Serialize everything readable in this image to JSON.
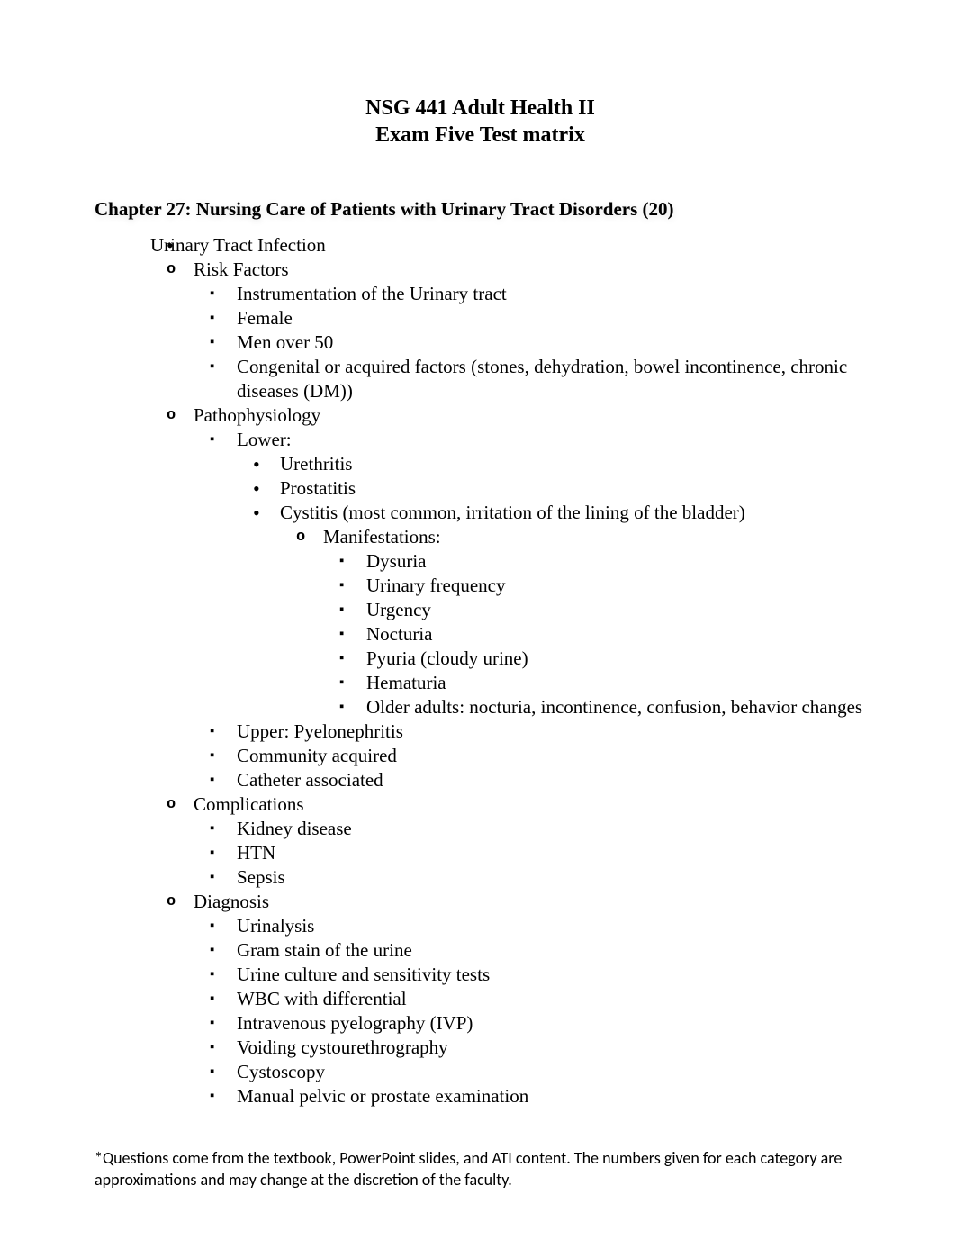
{
  "title": {
    "line1": "NSG 441 Adult Health II",
    "line2": "Exam Five Test matrix"
  },
  "chapter_heading": "Chapter 27: Nursing Care of Patients with Urinary Tract Disorders (20)",
  "outline": {
    "topic": "Urinary Tract Infection",
    "sections": {
      "risk_factors": {
        "label": "Risk Factors",
        "items": [
          "Instrumentation of the Urinary tract",
          "Female",
          "Men over 50",
          "Congenital or acquired factors (stones, dehydration, bowel incontinence, chronic diseases (DM))"
        ]
      },
      "pathophysiology": {
        "label": "Pathophysiology",
        "lower": {
          "label": "Lower:",
          "items": {
            "urethritis": "Urethritis",
            "prostatitis": "Prostatitis",
            "cystitis": {
              "label": "Cystitis (most common, irritation of the lining of the bladder)",
              "manifestations_label": "Manifestations:",
              "manifestations": [
                "Dysuria",
                "Urinary frequency",
                "Urgency",
                "Nocturia",
                "Pyuria (cloudy urine)",
                "Hematuria",
                "Older adults: nocturia, incontinence, confusion, behavior changes"
              ]
            }
          }
        },
        "other_items": [
          "Upper: Pyelonephritis",
          "Community acquired",
          "Catheter associated"
        ]
      },
      "complications": {
        "label": "Complications",
        "items": [
          "Kidney disease",
          "HTN",
          "Sepsis"
        ]
      },
      "diagnosis": {
        "label": "Diagnosis",
        "items": [
          "Urinalysis",
          "Gram stain of the urine",
          "Urine culture and sensitivity tests",
          "WBC with differential",
          "Intravenous pyelography (IVP)",
          "Voiding cystourethrography",
          "Cystoscopy",
          "Manual pelvic or prostate examination"
        ]
      }
    }
  },
  "footnote": "*Questions come from the textbook, PowerPoint slides, and ATI content.  The numbers given for each category are approximations and may change at the discretion of the faculty."
}
